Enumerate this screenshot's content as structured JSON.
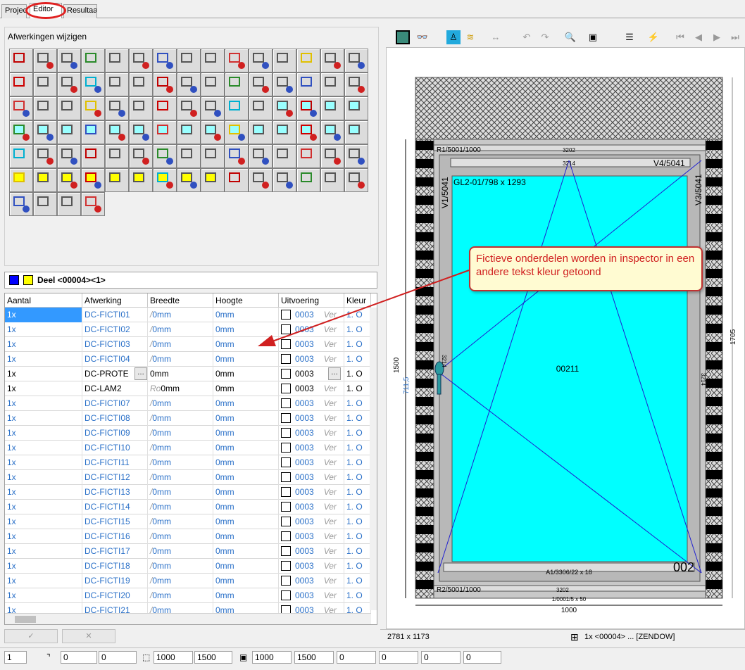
{
  "tabs": [
    {
      "label": "Project"
    },
    {
      "label": "Editor"
    },
    {
      "label": "Resultaat"
    }
  ],
  "left_panel": {
    "title": "Afwerkingen wijzigen"
  },
  "selector": {
    "label": "Deel <00004><1>",
    "color1": "#0000ff",
    "color2": "#ffff00"
  },
  "table": {
    "columns": [
      "Aantal",
      "Afwerking",
      "Breedte",
      "Hoogte",
      "Uitvoering",
      "Kleur"
    ],
    "rows": [
      {
        "aantal": "1x",
        "afwerking": "DC-FICTI01",
        "pre": "/",
        "breedte": "0mm",
        "hoogte": "0mm",
        "uitvoering": "0003",
        "ver": "Ver",
        "kleur": "1. O",
        "type": "fict"
      },
      {
        "aantal": "1x",
        "afwerking": "DC-FICTI02",
        "pre": "/",
        "breedte": "0mm",
        "hoogte": "0mm",
        "uitvoering": "0003",
        "ver": "Ver",
        "kleur": "1. O",
        "type": "fict"
      },
      {
        "aantal": "1x",
        "afwerking": "DC-FICTI03",
        "pre": "/",
        "breedte": "0mm",
        "hoogte": "0mm",
        "uitvoering": "0003",
        "ver": "Ver",
        "kleur": "1. O",
        "type": "fict"
      },
      {
        "aantal": "1x",
        "afwerking": "DC-FICTI04",
        "pre": "/",
        "breedte": "0mm",
        "hoogte": "0mm",
        "uitvoering": "0003",
        "ver": "Ver",
        "kleur": "1. O",
        "type": "fict"
      },
      {
        "aantal": "1x",
        "afwerking": "DC-PROTE",
        "pre": "",
        "breedte": "0mm",
        "hoogte": "0mm",
        "uitvoering": "0003",
        "ver": "",
        "kleur": "1. O",
        "type": "edit"
      },
      {
        "aantal": "1x",
        "afwerking": "DC-LAM2",
        "pre": "Ro",
        "breedte": "0mm",
        "hoogte": "0mm",
        "uitvoering": "0003",
        "ver": "Ver",
        "kleur": "1. O",
        "type": "normal"
      },
      {
        "aantal": "1x",
        "afwerking": "DC-FICTI07",
        "pre": "/",
        "breedte": "0mm",
        "hoogte": "0mm",
        "uitvoering": "0003",
        "ver": "Ver",
        "kleur": "1. O",
        "type": "fict"
      },
      {
        "aantal": "1x",
        "afwerking": "DC-FICTI08",
        "pre": "/",
        "breedte": "0mm",
        "hoogte": "0mm",
        "uitvoering": "0003",
        "ver": "Ver",
        "kleur": "1. O",
        "type": "fict"
      },
      {
        "aantal": "1x",
        "afwerking": "DC-FICTI09",
        "pre": "/",
        "breedte": "0mm",
        "hoogte": "0mm",
        "uitvoering": "0003",
        "ver": "Ver",
        "kleur": "1. O",
        "type": "fict"
      },
      {
        "aantal": "1x",
        "afwerking": "DC-FICTI10",
        "pre": "/",
        "breedte": "0mm",
        "hoogte": "0mm",
        "uitvoering": "0003",
        "ver": "Ver",
        "kleur": "1. O",
        "type": "fict"
      },
      {
        "aantal": "1x",
        "afwerking": "DC-FICTI11",
        "pre": "/",
        "breedte": "0mm",
        "hoogte": "0mm",
        "uitvoering": "0003",
        "ver": "Ver",
        "kleur": "1. O",
        "type": "fict"
      },
      {
        "aantal": "1x",
        "afwerking": "DC-FICTI12",
        "pre": "/",
        "breedte": "0mm",
        "hoogte": "0mm",
        "uitvoering": "0003",
        "ver": "Ver",
        "kleur": "1. O",
        "type": "fict"
      },
      {
        "aantal": "1x",
        "afwerking": "DC-FICTI13",
        "pre": "/",
        "breedte": "0mm",
        "hoogte": "0mm",
        "uitvoering": "0003",
        "ver": "Ver",
        "kleur": "1. O",
        "type": "fict"
      },
      {
        "aantal": "1x",
        "afwerking": "DC-FICTI14",
        "pre": "/",
        "breedte": "0mm",
        "hoogte": "0mm",
        "uitvoering": "0003",
        "ver": "Ver",
        "kleur": "1. O",
        "type": "fict"
      },
      {
        "aantal": "1x",
        "afwerking": "DC-FICTI15",
        "pre": "/",
        "breedte": "0mm",
        "hoogte": "0mm",
        "uitvoering": "0003",
        "ver": "Ver",
        "kleur": "1. O",
        "type": "fict"
      },
      {
        "aantal": "1x",
        "afwerking": "DC-FICTI16",
        "pre": "/",
        "breedte": "0mm",
        "hoogte": "0mm",
        "uitvoering": "0003",
        "ver": "Ver",
        "kleur": "1. O",
        "type": "fict"
      },
      {
        "aantal": "1x",
        "afwerking": "DC-FICTI17",
        "pre": "/",
        "breedte": "0mm",
        "hoogte": "0mm",
        "uitvoering": "0003",
        "ver": "Ver",
        "kleur": "1. O",
        "type": "fict"
      },
      {
        "aantal": "1x",
        "afwerking": "DC-FICTI18",
        "pre": "/",
        "breedte": "0mm",
        "hoogte": "0mm",
        "uitvoering": "0003",
        "ver": "Ver",
        "kleur": "1. O",
        "type": "fict"
      },
      {
        "aantal": "1x",
        "afwerking": "DC-FICTI19",
        "pre": "/",
        "breedte": "0mm",
        "hoogte": "0mm",
        "uitvoering": "0003",
        "ver": "Ver",
        "kleur": "1. O",
        "type": "fict"
      },
      {
        "aantal": "1x",
        "afwerking": "DC-FICTI20",
        "pre": "/",
        "breedte": "0mm",
        "hoogte": "0mm",
        "uitvoering": "0003",
        "ver": "Ver",
        "kleur": "1. O",
        "type": "fict"
      },
      {
        "aantal": "1x",
        "afwerking": "DC-FICTI21",
        "pre": "/",
        "breedte": "0mm",
        "hoogte": "0mm",
        "uitvoering": "0003",
        "ver": "Ver",
        "kleur": "1. O",
        "type": "fict"
      }
    ]
  },
  "callout": {
    "text": "Fictieve onderdelen worden in inspector in een andere tekst kleur getoond"
  },
  "drawing": {
    "glass_label": "GL2-01/798 x 1293",
    "top_label": "R1/5001/1000",
    "v4_label": "V4/5041",
    "v1_label": "V1/5041",
    "v3_label": "V3/5041",
    "a1_label": "A1/3306/22 x 18",
    "r2_label": "R2/5001/1000",
    "dim_3202_top": "3202",
    "dim_3214_top": "3214",
    "dim_3202_bottom": "3202",
    "center_label": "00211",
    "corner_label": "002",
    "dim_1500": "1500",
    "dim_711": "711,5",
    "dim_1705": "1705",
    "dim_1000": "1000",
    "dim_bottom_small": "1/0001/5 x 50",
    "dim_side_3214": "3214",
    "dim_side_left": "3214",
    "glass_color": "#00ffff"
  },
  "status": {
    "left": "2781 x 1173",
    "right": "1x <00004> ... [ZENDOW]"
  },
  "bottom": {
    "page": "1",
    "f1": "0",
    "f2": "0",
    "f3": "1000",
    "f4": "1500",
    "f5": "1000",
    "f6": "1500",
    "f7": "0",
    "f8": "0",
    "f9": "0",
    "f10": "0"
  }
}
